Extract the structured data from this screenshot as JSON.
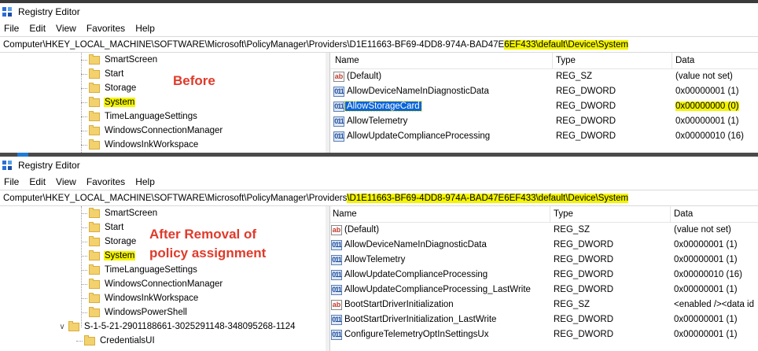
{
  "app": {
    "title": "Registry Editor"
  },
  "menu": [
    "File",
    "Edit",
    "View",
    "Favorites",
    "Help"
  ],
  "address": {
    "top_plain": "Computer\\HKEY_LOCAL_MACHINE\\SOFTWARE\\Microsoft\\PolicyManager\\Providers\\D1E11663-BF69-4DD8-974A-BAD47E",
    "top_hl": "6EF433\\default\\Device\\System",
    "bottom_plain": "Computer\\HKEY_LOCAL_MACHINE\\SOFTWARE\\Microsoft\\PolicyManager\\Providers",
    "bottom_hl": "\\D1E11663-BF69-4DD8-974A-BAD47E6EF433\\default\\Device\\System"
  },
  "annotations": {
    "before": "Before",
    "after_line1": "After Removal of",
    "after_line2": "policy assignment"
  },
  "columns": {
    "name": "Name",
    "type": "Type",
    "data": "Data"
  },
  "top": {
    "tree": [
      "SmartScreen",
      "Start",
      "Storage",
      "System",
      "TimeLanguageSettings",
      "WindowsConnectionManager",
      "WindowsInkWorkspace"
    ],
    "values": [
      {
        "name": "(Default)",
        "type": "REG_SZ",
        "data": "(value not set)",
        "icon": "string-value-icon"
      },
      {
        "name": "AllowDeviceNameInDiagnosticData",
        "type": "REG_DWORD",
        "data": "0x00000001 (1)",
        "icon": "dword-value-icon"
      },
      {
        "name": "AllowStorageCard",
        "type": "REG_DWORD",
        "data": "0x00000000 (0)",
        "icon": "dword-value-icon"
      },
      {
        "name": "AllowTelemetry",
        "type": "REG_DWORD",
        "data": "0x00000001 (1)",
        "icon": "dword-value-icon"
      },
      {
        "name": "AllowUpdateComplianceProcessing",
        "type": "REG_DWORD",
        "data": "0x00000010 (16)",
        "icon": "dword-value-icon"
      }
    ]
  },
  "bottom": {
    "tree": [
      "SmartScreen",
      "Start",
      "Storage",
      "System",
      "TimeLanguageSettings",
      "WindowsConnectionManager",
      "WindowsInkWorkspace",
      "WindowsPowerShell"
    ],
    "sid_key": "S-1-5-21-2901188661-3025291148-348095268-1124",
    "sid_child": "CredentialsUI",
    "values": [
      {
        "name": "(Default)",
        "type": "REG_SZ",
        "data": "(value not set)",
        "icon": "string-value-icon"
      },
      {
        "name": "AllowDeviceNameInDiagnosticData",
        "type": "REG_DWORD",
        "data": "0x00000001 (1)",
        "icon": "dword-value-icon"
      },
      {
        "name": "AllowTelemetry",
        "type": "REG_DWORD",
        "data": "0x00000001 (1)",
        "icon": "dword-value-icon"
      },
      {
        "name": "AllowUpdateComplianceProcessing",
        "type": "REG_DWORD",
        "data": "0x00000010 (16)",
        "icon": "dword-value-icon"
      },
      {
        "name": "AllowUpdateComplianceProcessing_LastWrite",
        "type": "REG_DWORD",
        "data": "0x00000001 (1)",
        "icon": "dword-value-icon"
      },
      {
        "name": "BootStartDriverInitialization",
        "type": "REG_SZ",
        "data": "<enabled /><data id",
        "icon": "string-value-icon"
      },
      {
        "name": "BootStartDriverInitialization_LastWrite",
        "type": "REG_DWORD",
        "data": "0x00000001 (1)",
        "icon": "dword-value-icon"
      },
      {
        "name": "ConfigureTelemetryOptInSettingsUx",
        "type": "REG_DWORD",
        "data": "0x00000001 (1)",
        "icon": "dword-value-icon"
      }
    ]
  },
  "colors": {
    "highlight": "#f4f400",
    "selection": "#0a64d8",
    "annotation": "#e03a2a"
  }
}
